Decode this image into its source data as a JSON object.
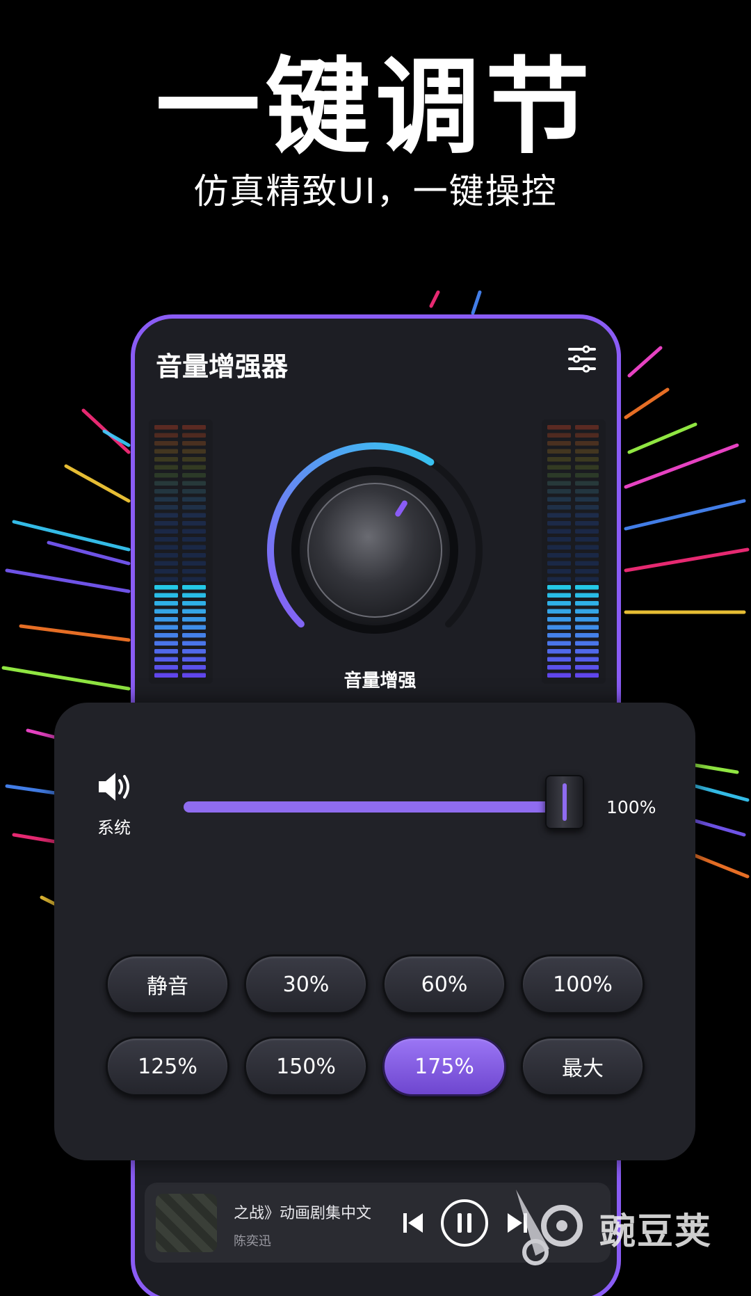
{
  "header": {
    "headline": "一键调节",
    "subline": "仿真精致UI，一键操控"
  },
  "app": {
    "title": "音量增强器",
    "settings_icon": "sliders-icon",
    "knob_label": "音量增强",
    "knob_level": 0.62,
    "accent_color": "#8a5cf5",
    "meter_lit_segments": 12,
    "meter_total_segments": 32
  },
  "volume_panel": {
    "channel_label": "系统",
    "speaker_icon": "speaker-icon",
    "slider_value_text": "100%",
    "slider_fraction": 1.0,
    "presets": [
      {
        "label": "静音",
        "active": false
      },
      {
        "label": "30%",
        "active": false
      },
      {
        "label": "60%",
        "active": false
      },
      {
        "label": "100%",
        "active": false
      },
      {
        "label": "125%",
        "active": false
      },
      {
        "label": "150%",
        "active": false
      },
      {
        "label": "175%",
        "active": true
      },
      {
        "label": "最大",
        "active": false
      }
    ]
  },
  "player": {
    "title": "之战》动画剧集中文",
    "artist": "陈奕迅",
    "prev_icon": "previous-icon",
    "play_icon": "pause-icon",
    "next_icon": "next-icon"
  },
  "watermark": {
    "text": "豌豆荚"
  }
}
